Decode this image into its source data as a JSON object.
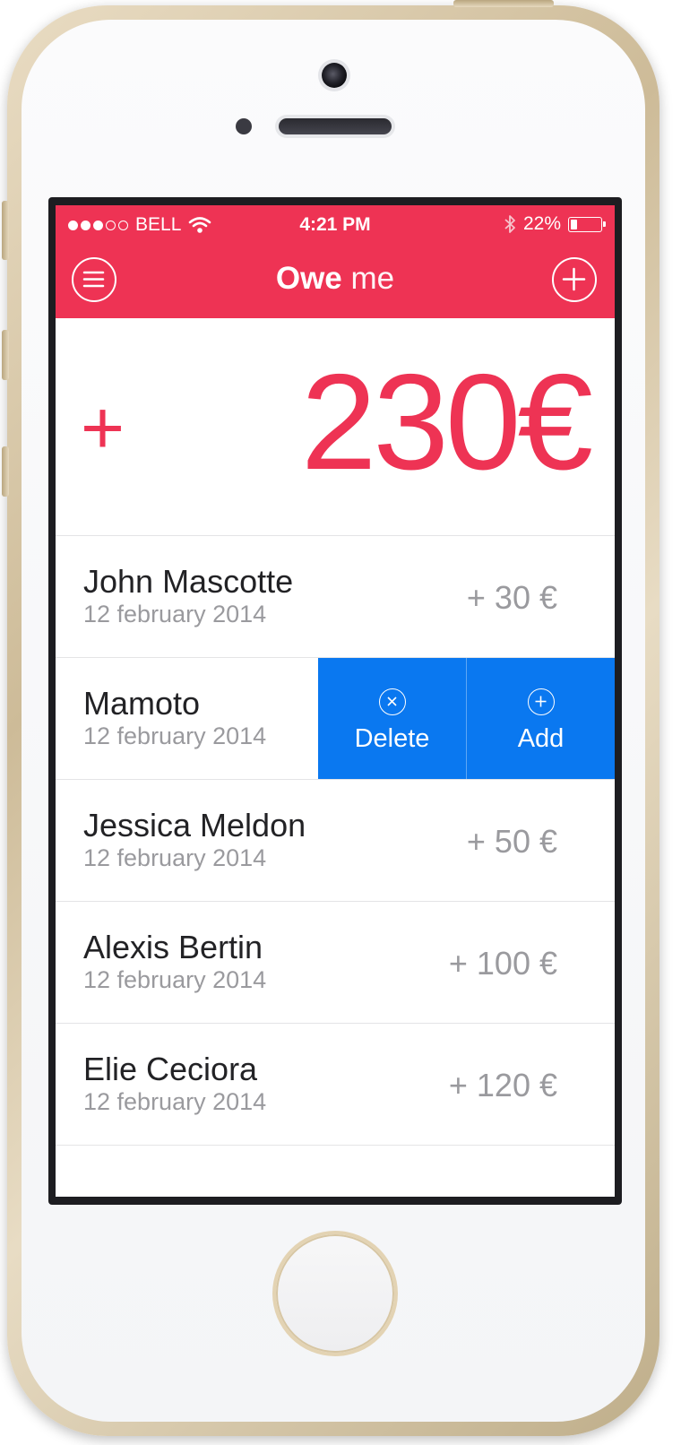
{
  "status_bar": {
    "carrier": "BELL",
    "time": "4:21 PM",
    "battery": "22%",
    "battery_level": 0.22
  },
  "header": {
    "title_strong": "Owe",
    "title_light": "me",
    "menu_icon": "hamburger-circle-icon",
    "add_icon": "plus-circle-icon"
  },
  "total": {
    "sign": "+",
    "amount": "230€"
  },
  "rows": [
    {
      "name": "John Mascotte",
      "date": "12 february 2014",
      "amount": "+ 30 €"
    },
    {
      "name": "Mamoto",
      "date": "12 february 2014",
      "amount": ""
    },
    {
      "name": "Jessica Meldon",
      "date": "12 february 2014",
      "amount": "+ 50 €"
    },
    {
      "name": "Alexis Bertin",
      "date": "12 february 2014",
      "amount": "+ 100 €"
    },
    {
      "name": "Elie Ceciora",
      "date": "12 february 2014",
      "amount": "+ 120 €"
    }
  ],
  "swipe_actions": {
    "delete_label": "Delete",
    "add_label": "Add"
  },
  "colors": {
    "accent": "#ee3354",
    "action_blue": "#0a78f0",
    "secondary_text": "#9a9a9e"
  }
}
